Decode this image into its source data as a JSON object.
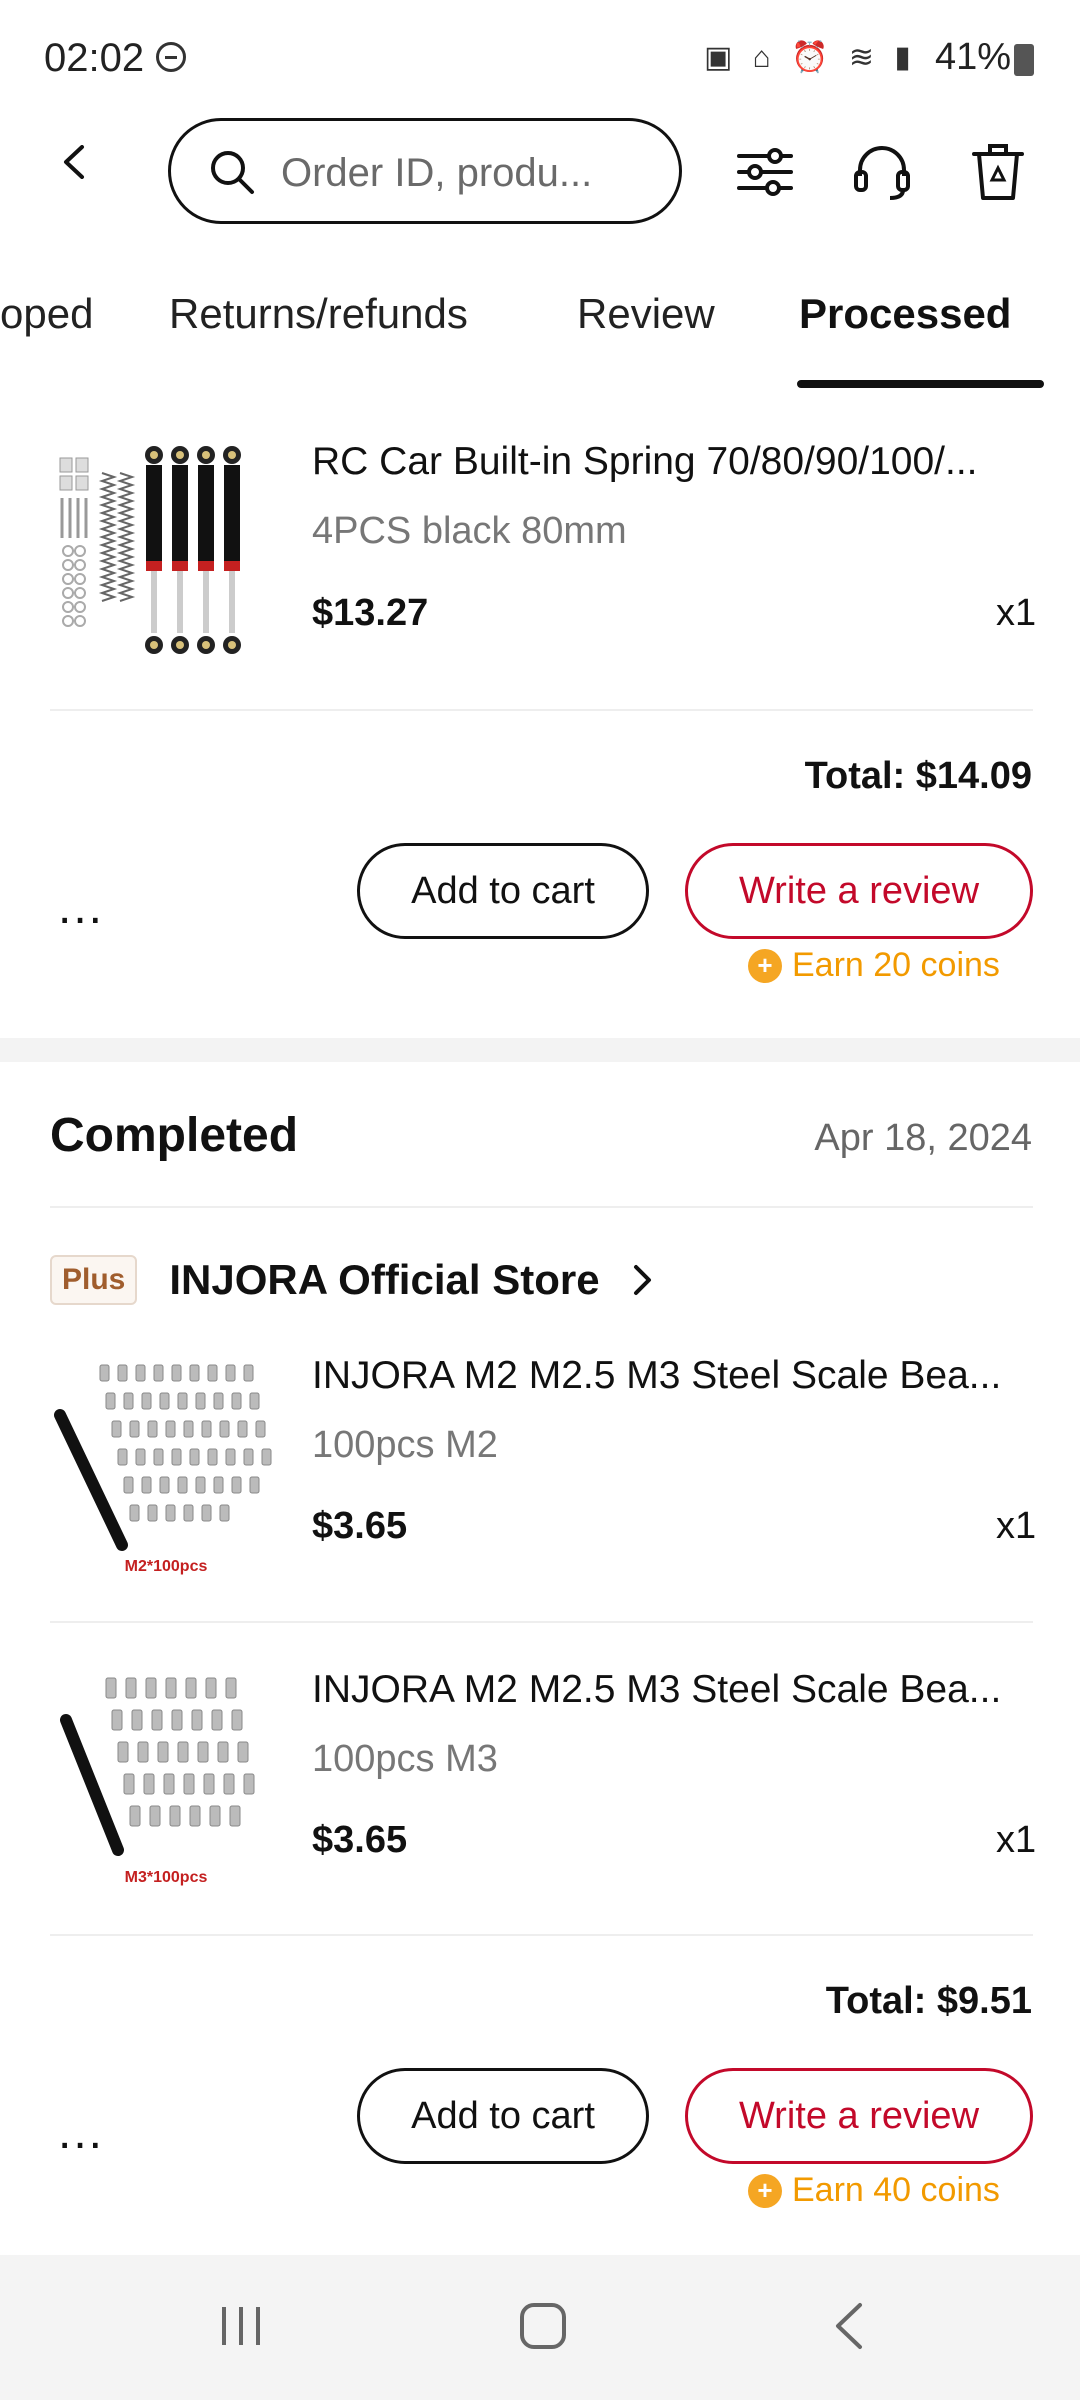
{
  "status_bar": {
    "time": "02:02",
    "battery": "41%"
  },
  "header": {
    "search_placeholder": "Order ID, produ..."
  },
  "tabs": [
    {
      "label": "oped"
    },
    {
      "label": "Returns/refunds"
    },
    {
      "label": "Review"
    },
    {
      "label": "Processed",
      "active": true
    }
  ],
  "order1": {
    "item": {
      "title": "RC Car Built-in Spring 70/80/90/100/...",
      "variant": "4PCS black 80mm",
      "price": "$13.27",
      "qty": "x1"
    },
    "total": "Total: $14.09",
    "more": "...",
    "add_to_cart": "Add to cart",
    "write_review": "Write a review",
    "coins": "Earn 20 coins"
  },
  "order2": {
    "status": "Completed",
    "date": "Apr 18, 2024",
    "store_badge": "Plus",
    "store_name": "INJORA Official Store",
    "items": [
      {
        "title": "INJORA M2 M2.5 M3 Steel Scale Bea...",
        "variant": "100pcs M2",
        "price": "$3.65",
        "qty": "x1",
        "thumb_label": "M2*100pcs"
      },
      {
        "title": "INJORA M2 M2.5 M3 Steel Scale Bea...",
        "variant": "100pcs M3",
        "price": "$3.65",
        "qty": "x1",
        "thumb_label": "M3*100pcs"
      }
    ],
    "total": "Total: $9.51",
    "more": "...",
    "add_to_cart": "Add to cart",
    "write_review": "Write a review",
    "coins": "Earn 40 coins"
  },
  "colors": {
    "accent_red": "#c3092a",
    "coin_orange": "#f29a00"
  }
}
